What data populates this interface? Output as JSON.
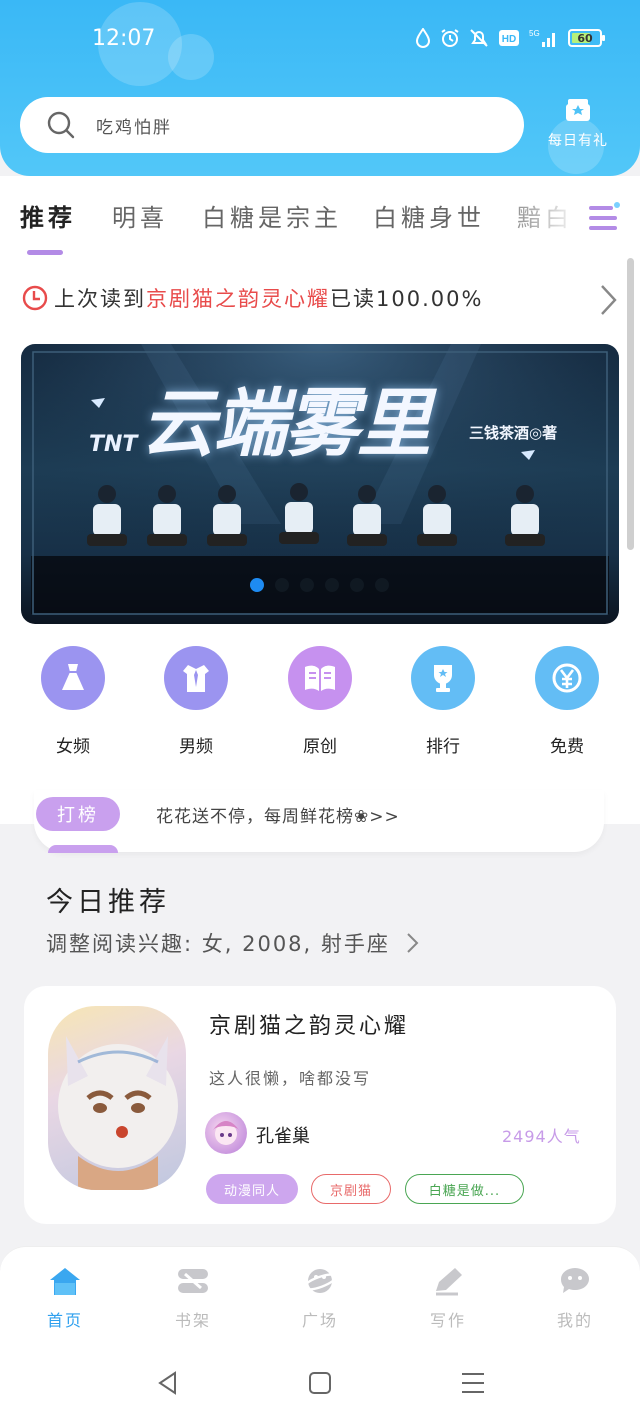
{
  "status_bar": {
    "time": "12:07",
    "battery": "60",
    "network": "5G",
    "hd": "HD"
  },
  "search": {
    "placeholder": "吃鸡怕胖"
  },
  "daily_gift": {
    "label": "每日有礼"
  },
  "tabs": [
    {
      "label": "推荐",
      "active": true
    },
    {
      "label": "明喜",
      "active": false
    },
    {
      "label": "白糖是宗主",
      "active": false
    },
    {
      "label": "白糖身世",
      "active": false
    },
    {
      "label": "黯白",
      "active": false
    }
  ],
  "last_read": {
    "prefix": "上次读到",
    "book": "京剧猫之韵灵心耀",
    "suffix": "已读100.00%"
  },
  "banner": {
    "title": "云端雾里",
    "tnt": "TNT",
    "author": "三钱茶酒◎著",
    "slides": 6,
    "active_slide": 0
  },
  "categories": [
    {
      "label": "女频",
      "icon": "dress-icon",
      "color": "#9b94f0"
    },
    {
      "label": "男频",
      "icon": "shirt-icon",
      "color": "#9b94f0"
    },
    {
      "label": "原创",
      "icon": "book-open-icon",
      "color": "#c691ef"
    },
    {
      "label": "排行",
      "icon": "trophy-icon",
      "color": "#63bdf5"
    },
    {
      "label": "免费",
      "icon": "yen-coin-icon",
      "color": "#63bdf5"
    }
  ],
  "notice": {
    "tag": "打榜",
    "text": "花花送不停，每周鲜花榜❀>>"
  },
  "today": {
    "title": "今日推荐",
    "subtitle": "调整阅读兴趣: 女, 2008, 射手座"
  },
  "book_card": {
    "title": "京剧猫之韵灵心耀",
    "description": "这人很懒，啥都没写",
    "author": "孔雀巢",
    "popularity": "2494人气",
    "tags": [
      "动漫同人",
      "京剧猫",
      "白糖是做..."
    ]
  },
  "bottom_nav": [
    {
      "label": "首页",
      "icon": "home-icon",
      "active": true
    },
    {
      "label": "书架",
      "icon": "bookshelf-icon",
      "active": false
    },
    {
      "label": "广场",
      "icon": "planet-icon",
      "active": false
    },
    {
      "label": "写作",
      "icon": "pen-icon",
      "active": false
    },
    {
      "label": "我的",
      "icon": "chat-face-icon",
      "active": false
    }
  ],
  "colors": {
    "header": "#3ab8f6",
    "accent": "#b38be6",
    "nav_active": "#2fa0ee",
    "red": "#e84b4b"
  }
}
